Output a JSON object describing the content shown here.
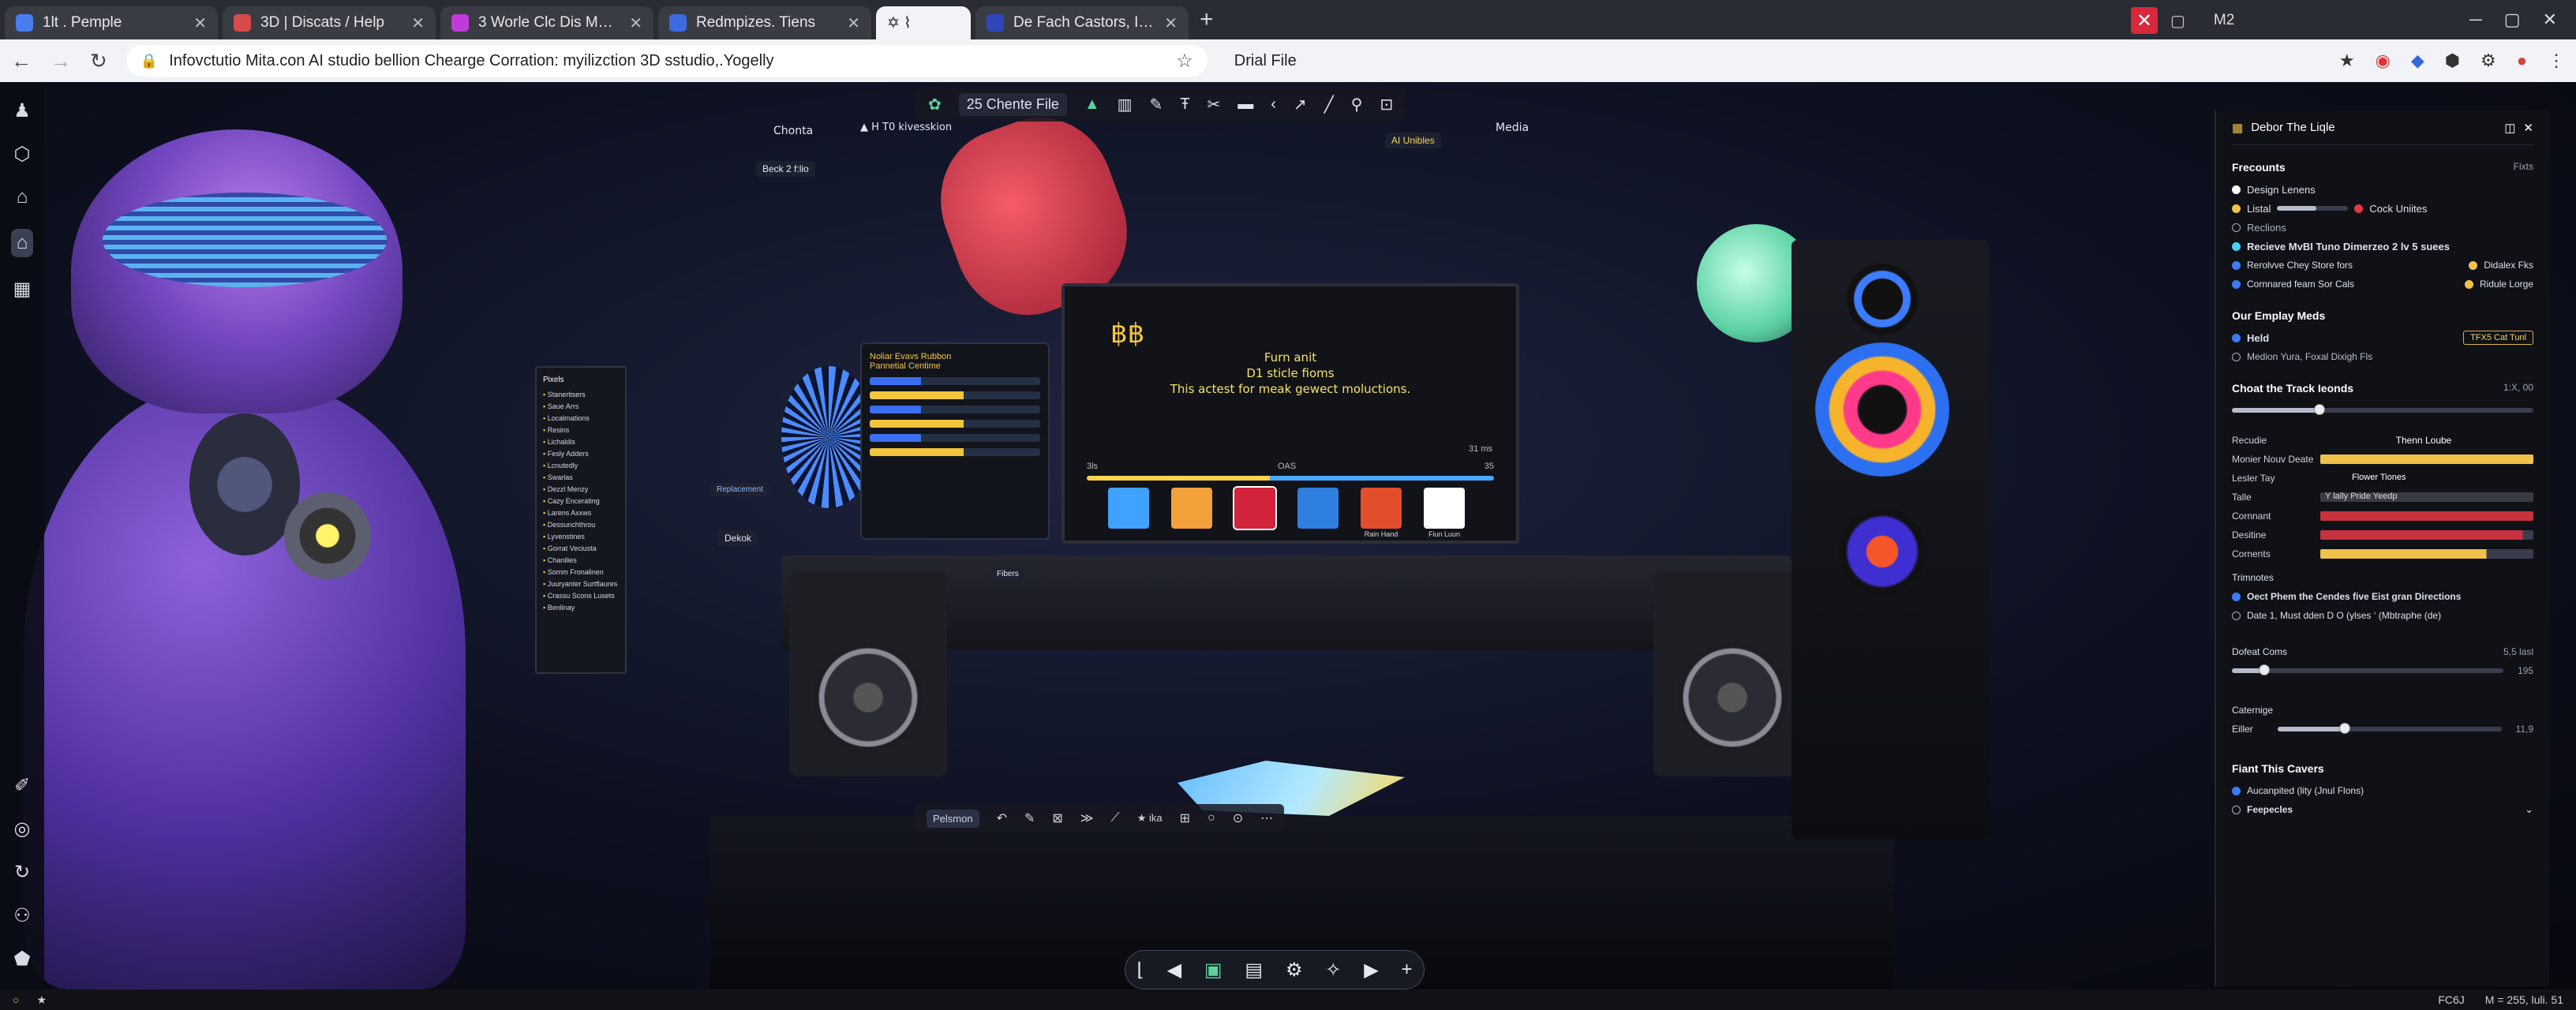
{
  "browser": {
    "tabs": [
      {
        "title": "1lt . Pemple",
        "favicon_color": "#4a7df0"
      },
      {
        "title": "3D | Discats / Help",
        "favicon_color": "#d64b4b"
      },
      {
        "title": "3 Worle Clc Dis Meem",
        "favicon_color": "#c03bd8"
      },
      {
        "title": "Redmpizes. Tiens",
        "favicon_color": "#3c6be0"
      },
      {
        "title": "✡ ⌇",
        "favicon_color": "#444444"
      },
      {
        "title": "De Fach Castors, Ine Shat",
        "favicon_color": "#2c48b8"
      }
    ],
    "active_tab": 4,
    "right_tab_text": "M2",
    "url": "Infovctutio Mita.con AI studio bellion Chearge Corration: myilizction 3D sstudio,.Yogelly",
    "secondary_box": "Drial File"
  },
  "scene_toolbar": {
    "file_label": "25 Chente File",
    "icons": [
      "cursor-icon",
      "chart-icon",
      "pen-icon",
      "text-icon",
      "scissors-icon",
      "folder-icon",
      "back-icon",
      "arrow-icon",
      "brush-icon",
      "pin-icon",
      "frame-icon"
    ]
  },
  "scene": {
    "labels": {
      "chonta": "Chonta",
      "kivesskion": "▲ H T0 kivesskion",
      "beck": "Beck 2 f:lio",
      "media": "Media",
      "ai_unibles": "AI Unibles",
      "delete": "Dekok",
      "replacement": "Replacement",
      "notes": "Noliar Evavs Rubbon\nPannetial Centime",
      "fibers": "Fibers"
    },
    "monitor": {
      "glyph": "฿฿",
      "line1": "Furn anit",
      "line2": "D1 sticle fioms",
      "line3": "This actest for meak gewect moluctions.",
      "left_num": "3ls",
      "mid_text": "OAS",
      "right_num": "35",
      "time": "31 ms",
      "thumbs": [
        {
          "color": "#3fa2ff",
          "caption": ""
        },
        {
          "color": "#f2a13b",
          "caption": ""
        },
        {
          "color": "#d2233a",
          "caption": ""
        },
        {
          "color": "#2f7fe0",
          "caption": ""
        },
        {
          "color": "#e24d2c",
          "caption": "Rain Hand"
        },
        {
          "color": "#ffffff",
          "caption": "Fiun Luun"
        }
      ]
    },
    "left_panel": {
      "title": "Pixels",
      "items": [
        "Stanertisers",
        "Saue Arrs",
        "Localmations",
        "Resins",
        "Lichaldis",
        "Fesly Adders",
        "Lcnutedly",
        "Swarlas",
        "Dezzl Menzy",
        "Cazy Encerating",
        "Larens Axxws",
        "Dessunchthrou",
        "Lyvenstines",
        "Gorrat Veciusta",
        "Chanilies",
        "Somm Fronalinen",
        "Juuryanter Surtflaures",
        "Crassu Scons Lusets",
        "Benlinay"
      ]
    },
    "mid_toolbar": {
      "pill": "Pelsmon",
      "aka": "★ ika"
    },
    "bottom_toolbar": [
      "frame-icon",
      "rewind-icon",
      "image-icon",
      "box-icon",
      "gear-icon",
      "sparkle-icon",
      "play-icon",
      "plus-icon"
    ]
  },
  "panel": {
    "title": "Debor The Liqle",
    "frecounts": {
      "title": "Frecounts",
      "right": "Fixts",
      "design_lenses": "Design Lenens",
      "listal": "Listal",
      "cock_unites": "Cock Uniites",
      "reclions": "Reclions",
      "recieve": "Recieve MvBI Tuno Dimerzeo 2 lv 5 suees",
      "resolve": "Rerolvve Chey Store fors",
      "didalex": "Didalex Fks",
      "cornnared": "Cornnared feam Sor Cals",
      "riduke": "Ridule Lorge",
      "listal_value": 0.55
    },
    "employ": {
      "title": "Our Emplay Meds",
      "held": "Held",
      "badge": "TFX5 Cat Tunl",
      "sub": "Medion Yura, Foxal Dixigh Fls"
    },
    "track": {
      "title": "Choat the Track Ieonds",
      "value": "1:X, 00",
      "slider": 0.29
    },
    "props": {
      "head_left": "Recudie",
      "head_right": "Thenn Loube",
      "rows": [
        {
          "label": "Monier Nouv Deate",
          "color": "#f1c24a",
          "text": "",
          "fill": 1.0
        },
        {
          "label": "Lesler Tay",
          "color": "",
          "text": "Flower Tiones",
          "fill": 0
        },
        {
          "label": "Talle",
          "color": "#3a3c45",
          "text": "Y lally Pride    Yeedp",
          "fill": 1.0
        },
        {
          "label": "Cornnant",
          "color": "#c8323f",
          "text": "",
          "fill": 1.0
        },
        {
          "label": "Desitine",
          "color": "#c8323f",
          "text": "",
          "fill": 0.95
        },
        {
          "label": "Cornents",
          "color": "#f1c24a",
          "text": "",
          "fill": 0.78
        }
      ]
    },
    "timnotes": {
      "title": "Trimnotes",
      "line1": "Oect Phem the Cendes five Eist gran Directions",
      "line2": "Date 1, Must dden D O (ylses  ‘ (Mbtraphe (de)"
    },
    "dofeat": {
      "title": "Dofeat Coms",
      "value": "5,5 lasl",
      "slider": 0.12,
      "max": "195"
    },
    "cateriage": {
      "title": "Caternige",
      "label": "Eiller",
      "slider": 0.3,
      "value": "11,9"
    },
    "fiant": {
      "title": "Fiant This Cavers",
      "opt1": "Aucanpited (lity (Jnul Flons)",
      "opt2": "Feepecles"
    }
  },
  "status": {
    "right1": "FC6J",
    "right2": "M = 255, luli. 51"
  }
}
